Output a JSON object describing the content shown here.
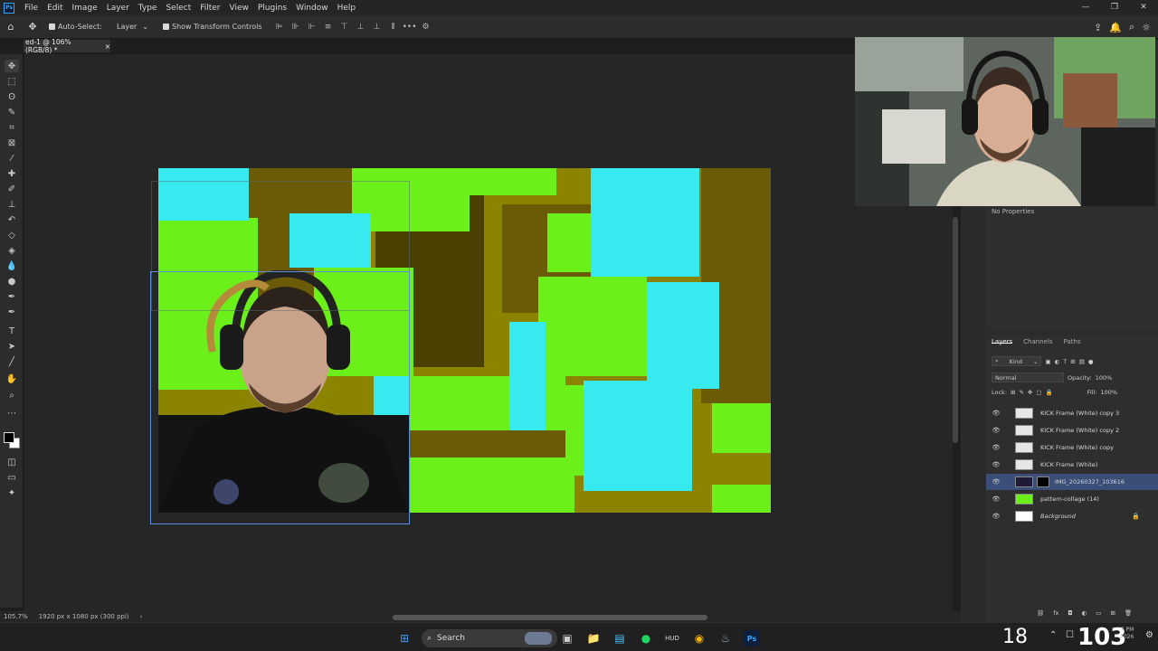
{
  "app": {
    "logo": "Ps"
  },
  "menu": [
    "File",
    "Edit",
    "Image",
    "Layer",
    "Type",
    "Select",
    "Filter",
    "View",
    "Plugins",
    "Window",
    "Help"
  ],
  "options": {
    "auto_select_label": "Auto-Select:",
    "auto_select_value": "Layer",
    "transform_label": "Show Transform Controls"
  },
  "document": {
    "tab_title": "ed-1 @ 106% (RGB/8) *"
  },
  "status": {
    "zoom": "105.7%",
    "doc_info": "1920 px x 1080 px (300 ppi)"
  },
  "properties": {
    "title": "No Properties"
  },
  "layers_panel": {
    "tabs": [
      "Layers",
      "Channels",
      "Paths"
    ],
    "filter_kind": "Kind",
    "blend_mode": "Normal",
    "opacity_label": "Opacity:",
    "opacity_value": "100%",
    "lock_label": "Lock:",
    "fill_label": "Fill:",
    "fill_value": "100%",
    "layers": [
      "KICK Frame (White) copy 3",
      "KICK Frame (White) copy 2",
      "KICK Frame (White) copy",
      "KICK Frame (White)",
      "IMG_20260327_103616",
      "pattern-collage (14)",
      "Background"
    ]
  },
  "taskbar": {
    "search_label": "Search",
    "weather_temp": "18",
    "clock_big": "103",
    "clock_small_time": "7 PM",
    "clock_small_year": "2026"
  },
  "colors": {
    "accent_blue": "#31a8ff",
    "pattern_green": "#6bf01a",
    "pattern_cyan": "#36eaf0",
    "pattern_olive": "#8a8400",
    "selected_layer": "#3a4e78"
  }
}
